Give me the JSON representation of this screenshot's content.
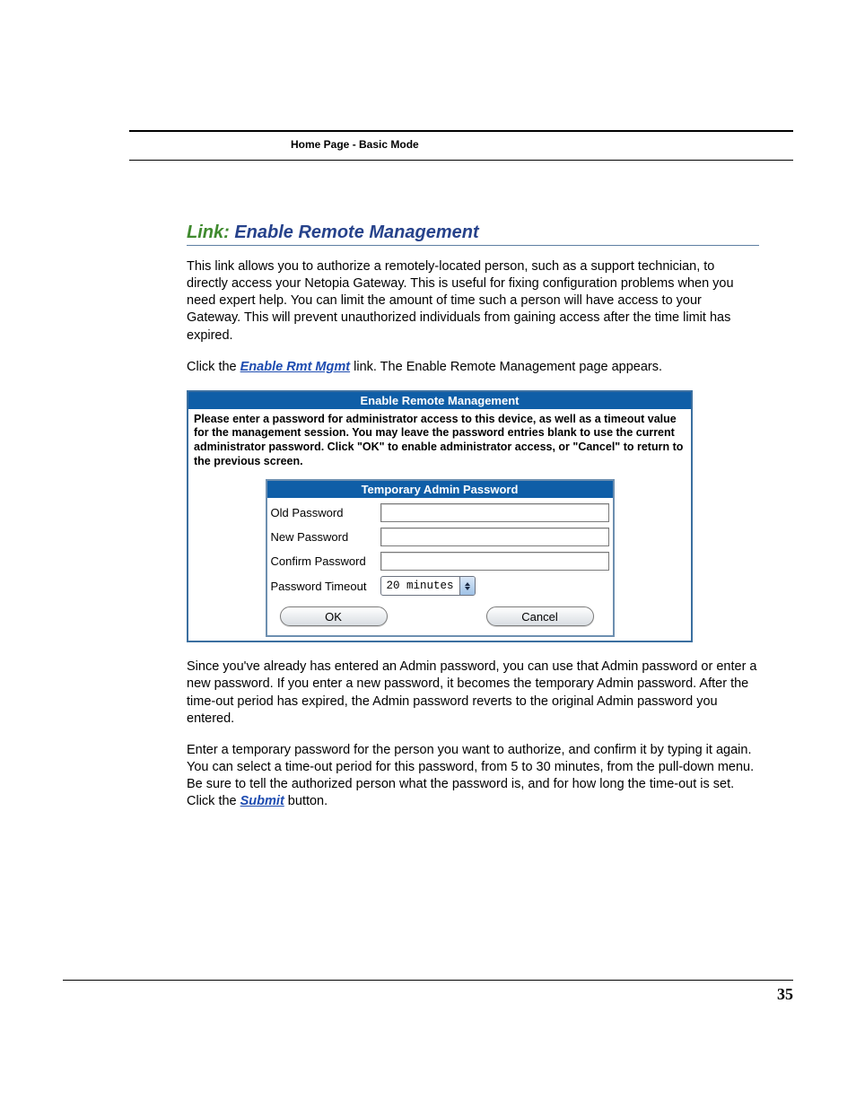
{
  "header": {
    "running_head": "Home Page - Basic Mode"
  },
  "heading": {
    "prefix": "Link:",
    "title": "Enable Remote Management"
  },
  "paragraphs": {
    "intro": "This link allows you to authorize a remotely-located person, such as a support technician, to directly access your Netopia Gateway. This is useful for fixing configuration problems when you need expert help. You can limit the amount of time such a person will have access to your Gateway. This will prevent unauthorized individuals from gaining access after the time limit has expired.",
    "click_before": "Click the ",
    "click_link": "Enable Rmt Mgmt",
    "click_after": " link. The Enable Remote Management page appears.",
    "after1": "Since you've already has entered an Admin password, you can use that Admin password or enter a new password. If you enter a new password, it becomes the temporary Admin password. After the time-out period has expired, the Admin password reverts to the original Admin password you entered.",
    "after2_before": "Enter a temporary password for the person you want to authorize, and confirm it by typing it again. You can select a time-out period for this password, from 5 to 30 minutes, from the pull-down menu. Be sure to tell the authorized person what the password is, and for how long the time-out is set. Click the ",
    "after2_link": "Submit",
    "after2_after": " button."
  },
  "figure": {
    "title": "Enable Remote Management",
    "instructions": "Please enter a password for administrator access to this device, as well as a timeout value for the management session. You may leave the password entries blank to use the current administrator password. Click \"OK\" to enable administrator access, or \"Cancel\" to return to the previous screen.",
    "inner_title": "Temporary Admin Password",
    "rows": {
      "old_password": "Old Password",
      "new_password": "New Password",
      "confirm_password": "Confirm Password",
      "password_timeout": "Password Timeout"
    },
    "timeout_value": "20 minutes",
    "buttons": {
      "ok": "OK",
      "cancel": "Cancel"
    }
  },
  "page_number": "35"
}
